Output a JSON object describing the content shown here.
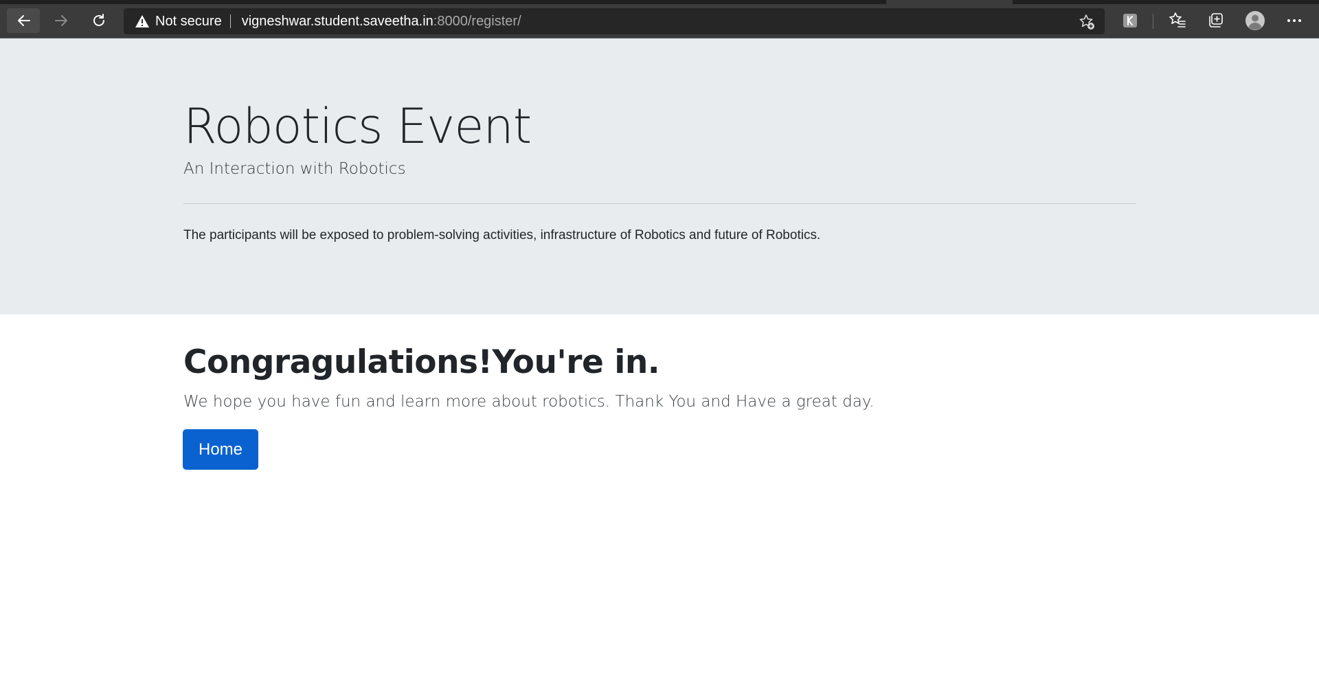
{
  "browser": {
    "security_label": "Not secure",
    "url_host": "vigneshwar.student.saveetha.in",
    "url_rest": ":8000/register/",
    "icons": {
      "back": "back-arrow-icon",
      "forward": "forward-arrow-icon",
      "reload": "reload-icon",
      "warning": "warning-triangle-icon",
      "add_favorite": "star-plus-icon",
      "extension": "extension-icon",
      "favorites": "favorites-list-icon",
      "collections": "collections-icon",
      "profile": "profile-avatar-icon",
      "menu": "more-menu-icon"
    },
    "colors": {
      "toolbar": "#3b3b3b",
      "address_bar": "#262626"
    }
  },
  "jumbotron": {
    "title": "Robotics Event",
    "subtitle": "An Interaction with Robotics",
    "description": "The participants will be exposed to problem-solving activities, infrastructure of Robotics and future of Robotics.",
    "background": "#e9ecef"
  },
  "main": {
    "heading": "Congragulations!You're in.",
    "message": "We hope you have fun and learn more about robotics. Thank You and Have a great day.",
    "home_button": "Home",
    "button_color": "#0a62d0"
  }
}
